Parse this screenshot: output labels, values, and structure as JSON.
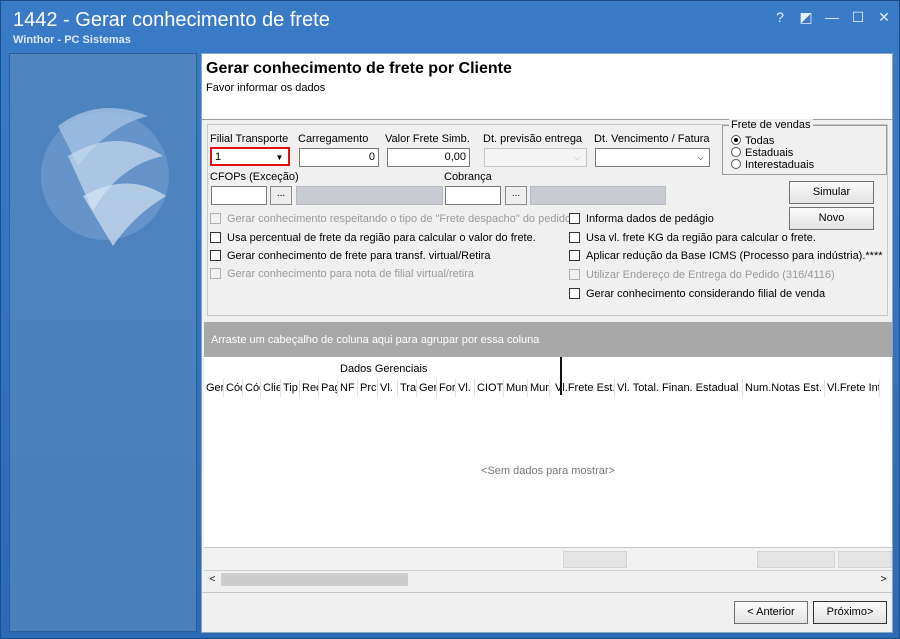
{
  "window": {
    "title": "1442 - Gerar conhecimento de frete",
    "subtitle": "Winthor - PC Sistemas",
    "controls": [
      "?",
      "◩",
      "—",
      "☐",
      "✕"
    ]
  },
  "header": {
    "title": "Gerar conhecimento de frete por Cliente",
    "subtitle": "Favor informar os dados"
  },
  "form": {
    "filial_label": "Filial Transporte",
    "filial_value": "1",
    "carregamento_label": "Carregamento",
    "carregamento_value": "0",
    "valor_frete_label": "Valor Frete Simb.",
    "valor_frete_value": "0,00",
    "dt_previsao_label": "Dt. previsão entrega",
    "dt_previsao_value": "",
    "dt_vencimento_label": "Dt. Vencimento / Fatura",
    "dt_vencimento_value": "",
    "cfops_label": "CFOPs (Exceção)",
    "cfops_value": "",
    "cobranca_label": "Cobrança",
    "cobranca_value": "",
    "ellipsis": "..."
  },
  "frete_vendas": {
    "title": "Frete de vendas",
    "options": [
      "Todas",
      "Estaduais",
      "Interestaduais"
    ],
    "selected": "Todas"
  },
  "buttons": {
    "simular": "Simular",
    "novo": "Novo",
    "anterior": "< Anterior",
    "proximo": "Próximo>"
  },
  "checks_left": [
    {
      "label": "Gerar conhecimento respeitando o tipo de \"Frete despacho\" do pedido.",
      "disabled": true
    },
    {
      "label": "Usa percentual de frete da região para calcular o valor do frete.",
      "disabled": false
    },
    {
      "label": "Gerar conhecimento de frete para transf. virtual/Retira",
      "disabled": false
    },
    {
      "label": "Gerar conhecimento para nota de filial virtual/retira",
      "disabled": true
    }
  ],
  "checks_right": [
    {
      "label": "Informa dados de pedágio",
      "disabled": false
    },
    {
      "label": "Usa vl. frete KG da região para calcular o frete.",
      "disabled": false
    },
    {
      "label": "Aplicar redução da Base ICMS (Processo para indústria).****",
      "disabled": false
    },
    {
      "label": "Utilizar Endereço de Entrega do Pedido (316/4116)",
      "disabled": true
    },
    {
      "label": "Gerar conhecimento considerando filial de venda",
      "disabled": false
    }
  ],
  "grid": {
    "group_hint": "Arraste um cabeçalho de coluna aqui para agrupar por essa coluna",
    "band": "Dados Gerenciais",
    "columns": [
      "Ger",
      "Cód",
      "Cód",
      "Clie",
      "Tip",
      "Rec",
      "Pag",
      "NF",
      "Prc",
      "Vl.",
      "Tra",
      "Ger",
      "For",
      "Vl.",
      "CIOT",
      "Mun",
      "Mun",
      "Vl.Frete Est.",
      "Vl. Total. Finan. Estadual",
      "Num.Notas Est.",
      "Vl.Frete Int"
    ],
    "empty": "<Sem dados para mostrar>"
  },
  "colors": {
    "title_bg": "#3a7bc8",
    "left_panel": "#4f84bf",
    "content_bg": "#f0f0f0",
    "highlight": "#e01010"
  }
}
